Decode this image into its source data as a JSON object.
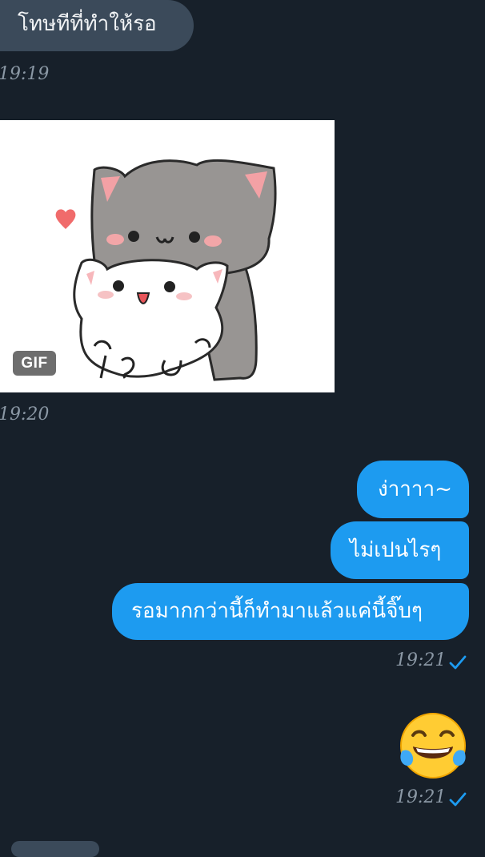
{
  "messages": {
    "incoming_text": "โทษทีที่ทำให้รอ",
    "incoming_time": "19:19",
    "gif_badge": "GIF",
    "gif_time": "19:20",
    "outgoing": [
      "ง่าาาา~",
      "ไม่เปนไรๆ",
      "รอมากกว่านี้ก็ทำมาแล้วแค่นี้จิ๊บๆ"
    ],
    "outgoing_time": "19:21",
    "emoji_time": "19:21"
  },
  "icons": {
    "read_status": "check-icon",
    "emoji": "face-with-tears-of-joy-icon"
  },
  "colors": {
    "background": "#17202a",
    "incoming_bubble": "#3b4a5a",
    "outgoing_bubble": "#1d9bf0",
    "timestamp": "#8b98a5",
    "check": "#1d9bf0"
  }
}
